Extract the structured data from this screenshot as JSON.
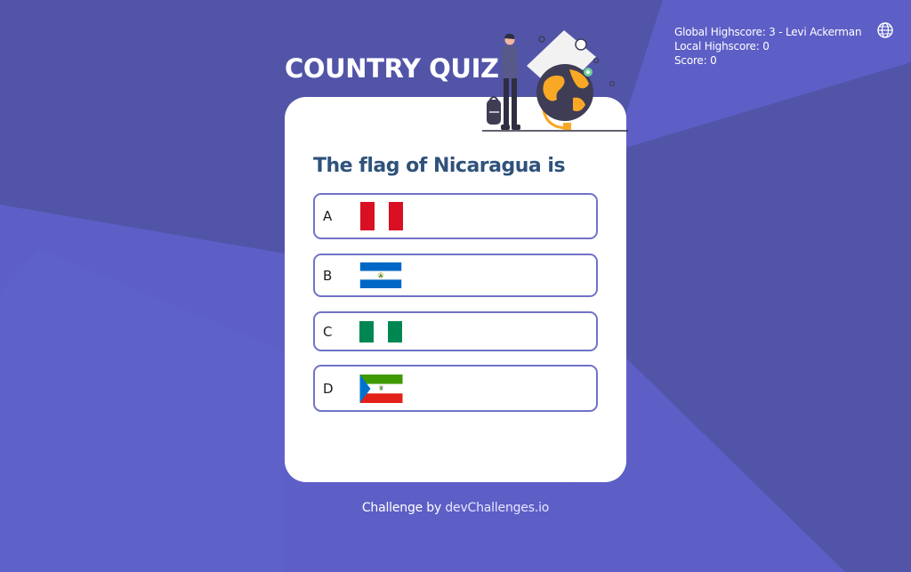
{
  "scores": {
    "global": "Global Highscore: 3 - Levi Ackerman",
    "local": "Local Highscore: 0",
    "score": "Score: 0",
    "language_icon": "globe-icon"
  },
  "quiz": {
    "title": "COUNTRY QUIZ",
    "question": "The flag of Nicaragua is",
    "options": [
      {
        "letter": "A",
        "flag": "peru-flag"
      },
      {
        "letter": "B",
        "flag": "nicaragua-flag"
      },
      {
        "letter": "C",
        "flag": "nigeria-flag"
      },
      {
        "letter": "D",
        "flag": "equatorial-guinea-flag"
      }
    ]
  },
  "footer": {
    "prefix": "Challenge by",
    "link": "devChallenges.io"
  },
  "colors": {
    "background": "#5d5fc6",
    "card": "#ffffff",
    "question": "#2f527b",
    "option_border": "#7072c8",
    "accent": "#f9a826"
  }
}
